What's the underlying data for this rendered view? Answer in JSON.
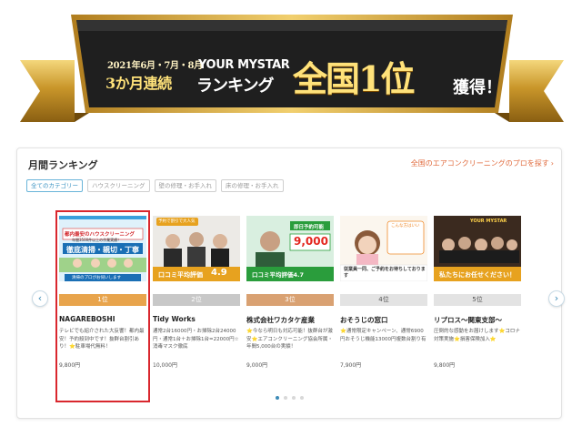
{
  "banner": {
    "date_line": "2021年6月・7月・8月",
    "consecutive": "3か月連続",
    "brand": "YOUR MYSTAR",
    "ranking": "ランキング",
    "first_place": "全国1位",
    "acquired": "獲得！",
    "colors": {
      "ribbon": "#2b2b2b",
      "gold": "#c9962a"
    }
  },
  "panel": {
    "title": "月間ランキング",
    "link": "全国のエアコンクリーニングのプロを探す",
    "filters": [
      {
        "label": "全てのカテゴリー",
        "active": true
      },
      {
        "label": "ハウスクリーニング",
        "active": false
      },
      {
        "label": "壁の修理・お手入れ",
        "active": false
      },
      {
        "label": "床の修理・お手入れ",
        "active": false
      }
    ],
    "cards": [
      {
        "rank": "1位",
        "name": "NAGAREBOSHI",
        "desc": "テレビでも紹介された大反響！都内最安！予約殺到中です！抜群台割引あり！⭐駐車場代無料！",
        "price": "9,800円",
        "thumb_texts": [
          "都内最安のハウスクリーニング",
          "年間3500件以上の作業実績！",
          "徹底清掃・親切・丁寧",
          "清掃のプロがお伺いします"
        ]
      },
      {
        "rank": "2位",
        "name": "Tidy Works",
        "desc": "通常2台16000円・お掃除2台24000円・通常1台＋お掃除1台=22000円☆消毒マスク徹底",
        "price": "10,000円",
        "thumb_texts": [
          "予約で割引で大人気",
          "口コミ平均評価",
          "4.9"
        ]
      },
      {
        "rank": "3位",
        "name": "株式会社ワカタケ産業",
        "desc": "⭐今なら明日も対応可能！抜群台が激安⭐エアコンクリーニング協会所属・年間5,000台の実績！",
        "price": "9,000円",
        "thumb_texts": [
          "即日予約可能",
          "9,000",
          "口コミ平均評価4.7"
        ]
      },
      {
        "rank": "4位",
        "name": "おそうじの窓口",
        "desc": "⭐通常限定キャンペーン、通常6900円おそうじ機能13000円複数台割り有",
        "price": "7,900円",
        "thumb_texts": [
          "こんな方はいい",
          "従業員一同、ご予約をお待ちしております"
        ]
      },
      {
        "rank": "5位",
        "name": "リプロス～関東支部～",
        "desc": "圧倒的な感動をお届けします⭐コロナ対策実施⭐損害保険加入⭐",
        "price": "9,800円",
        "thumb_texts": [
          "YOUR MYSTAR",
          "私たちにお任せください！"
        ]
      }
    ],
    "pagination": {
      "total": 4,
      "current": 1
    }
  }
}
